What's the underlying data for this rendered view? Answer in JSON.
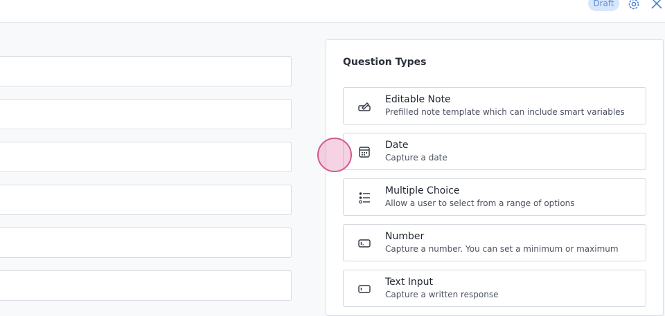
{
  "header": {
    "status_badge": "Draft",
    "settings_icon": "gear-icon",
    "close_icon": "close-icon"
  },
  "form": {
    "fields": [
      "",
      "",
      "",
      "",
      "",
      ""
    ]
  },
  "question_types": {
    "title": "Question Types",
    "items": [
      {
        "icon": "editable-note-icon",
        "title": "Editable Note",
        "description": "Prefilled note template which can include smart variables"
      },
      {
        "icon": "calendar-icon",
        "title": "Date",
        "description": "Capture a date"
      },
      {
        "icon": "list-icon",
        "title": "Multiple Choice",
        "description": "Allow a user to select from a range of options"
      },
      {
        "icon": "number-field-icon",
        "title": "Number",
        "description": "Capture a number. You can set a minimum or maximum"
      },
      {
        "icon": "text-field-icon",
        "title": "Text Input",
        "description": "Capture a written response"
      }
    ]
  },
  "colors": {
    "accent": "#5b8fd8",
    "badge_bg": "#d7e6fb",
    "cursor": "#d2588f"
  }
}
